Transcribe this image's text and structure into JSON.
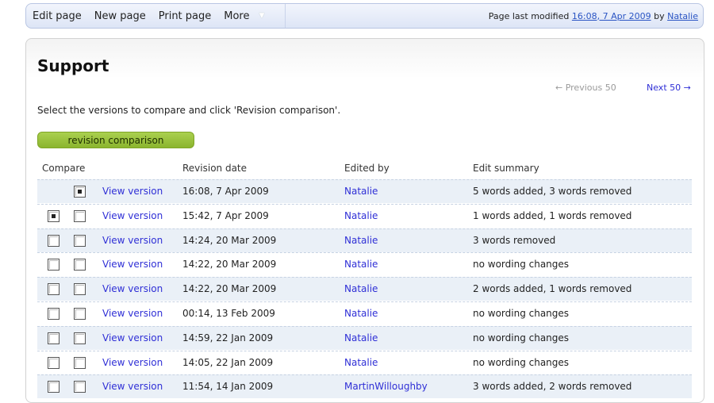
{
  "topbar": {
    "links": [
      "Edit page",
      "New page",
      "Print page"
    ],
    "more_label": "More",
    "modified_prefix": "Page last modified",
    "modified_time": "16:08, 7 Apr 2009",
    "modified_by_word": "by",
    "modified_user": "Natalie"
  },
  "page": {
    "title": "Support",
    "prev_label": "← Previous 50",
    "next_label": "Next 50 →",
    "instruction": "Select the versions to compare and click 'Revision comparison'.",
    "compare_button": "revision comparison"
  },
  "table": {
    "headers": [
      "Compare",
      "Revision date",
      "Edited by",
      "Edit summary"
    ],
    "rows": [
      {
        "view": "View version",
        "date": "16:08, 7 Apr 2009",
        "editor": "Natalie",
        "summary": "5 words added, 3 words removed",
        "left_box": false,
        "left_checked": false,
        "right_checked": true
      },
      {
        "view": "View version",
        "date": "15:42, 7 Apr 2009",
        "editor": "Natalie",
        "summary": "1 words added, 1 words removed",
        "left_box": true,
        "left_checked": true,
        "right_checked": false
      },
      {
        "view": "View version",
        "date": "14:24, 20 Mar 2009",
        "editor": "Natalie",
        "summary": "3 words removed",
        "left_box": true,
        "left_checked": false,
        "right_checked": false
      },
      {
        "view": "View version",
        "date": "14:22, 20 Mar 2009",
        "editor": "Natalie",
        "summary": "no wording changes",
        "left_box": true,
        "left_checked": false,
        "right_checked": false
      },
      {
        "view": "View version",
        "date": "14:22, 20 Mar 2009",
        "editor": "Natalie",
        "summary": "2 words added, 1 words removed",
        "left_box": true,
        "left_checked": false,
        "right_checked": false
      },
      {
        "view": "View version",
        "date": "00:14, 13 Feb 2009",
        "editor": "Natalie",
        "summary": "no wording changes",
        "left_box": true,
        "left_checked": false,
        "right_checked": false
      },
      {
        "view": "View version",
        "date": "14:59, 22 Jan 2009",
        "editor": "Natalie",
        "summary": "no wording changes",
        "left_box": true,
        "left_checked": false,
        "right_checked": false
      },
      {
        "view": "View version",
        "date": "14:05, 22 Jan 2009",
        "editor": "Natalie",
        "summary": "no wording changes",
        "left_box": true,
        "left_checked": false,
        "right_checked": false
      },
      {
        "view": "View version",
        "date": "11:54, 14 Jan 2009",
        "editor": "MartinWilloughby",
        "summary": "3 words added, 2 words removed",
        "left_box": true,
        "left_checked": false,
        "right_checked": false
      }
    ]
  }
}
